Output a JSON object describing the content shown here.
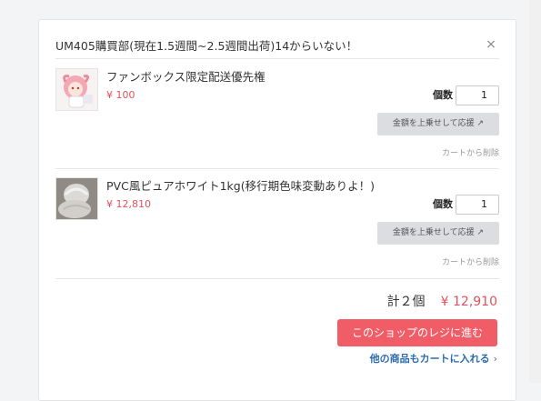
{
  "shop": {
    "title": "UM405購買部(現在1.5週間~2.5週間出荷)14からいない！",
    "close_symbol": "×"
  },
  "items": [
    {
      "name": "ファンボックス限定配送優先権",
      "price": "¥ 100",
      "qty_label": "個数",
      "qty": "1",
      "support_label": "金額を上乗せして応援 ↗",
      "remove_label": "カートから削除",
      "thumb_icon": "anime-figure-icon"
    },
    {
      "name": "PVC風ピュアホワイト1kg(移行期色味変動ありよ！)",
      "price": "¥ 12,810",
      "qty_label": "個数",
      "qty": "1",
      "support_label": "金額を上乗せして応援 ↗",
      "remove_label": "カートから削除",
      "thumb_icon": "white-clay-icon"
    }
  ],
  "summary": {
    "count_label": "計２個",
    "total_price": "¥ 12,910"
  },
  "actions": {
    "checkout_label": "このショップのレジに進む",
    "more_label": "他の商品もカートに入れる",
    "more_chevron": "›"
  },
  "colors": {
    "accent": "#f05d67",
    "price": "#e0535c",
    "link": "#2b6cb0"
  }
}
